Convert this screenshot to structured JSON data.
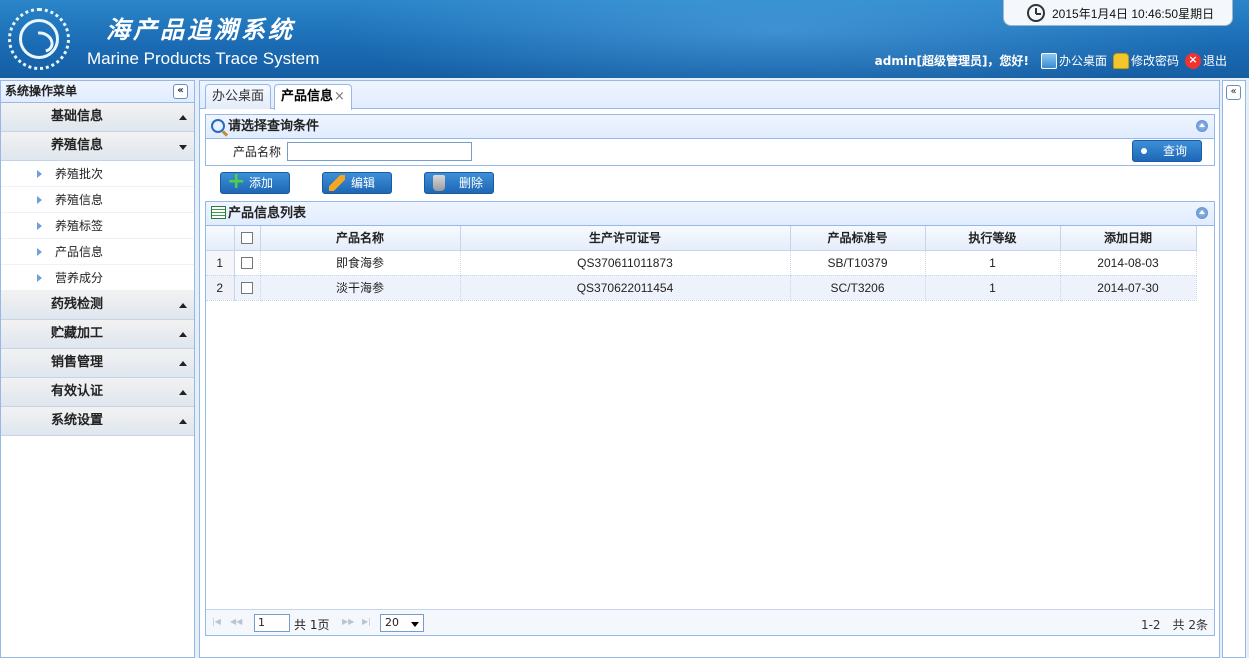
{
  "header": {
    "title_cn": "海产品追溯系统",
    "title_en": "Marine Products Trace System",
    "datetime": "2015年1月4日  10:46:50星期日",
    "greeting": "admin[超级管理员]，您好!",
    "links": {
      "desktop": "办公桌面",
      "change_password": "修改密码",
      "logout": "退出"
    }
  },
  "sidebar": {
    "title": "系统操作菜单",
    "collapse_glyph": "«",
    "groups": [
      {
        "label": "基础信息"
      },
      {
        "label": "养殖信息"
      },
      {
        "label": "药残检测"
      },
      {
        "label": "贮藏加工"
      },
      {
        "label": "销售管理"
      },
      {
        "label": "有效认证"
      },
      {
        "label": "系统设置"
      }
    ],
    "items": [
      {
        "label": "养殖批次"
      },
      {
        "label": "养殖信息"
      },
      {
        "label": "养殖标签"
      },
      {
        "label": "产品信息"
      },
      {
        "label": "营养成分"
      }
    ]
  },
  "tabs": [
    {
      "label": "办公桌面"
    },
    {
      "label": "产品信息",
      "close": "×"
    }
  ],
  "query": {
    "title": "请选择查询条件",
    "field_label": "产品名称",
    "field_value": "",
    "button": "查询"
  },
  "toolbar": {
    "add": "添加",
    "edit": "编辑",
    "delete": "删除"
  },
  "list": {
    "title": "产品信息列表",
    "columns": [
      "产品名称",
      "生产许可证号",
      "产品标准号",
      "执行等级",
      "添加日期"
    ],
    "rows": [
      {
        "n": "1",
        "name": "即食海参",
        "license": "QS370611011873",
        "standard": "SB/T10379",
        "level": "1",
        "date": "2014-08-03"
      },
      {
        "n": "2",
        "name": "淡干海参",
        "license": "QS370622011454",
        "standard": "SC/T3206",
        "level": "1",
        "date": "2014-07-30"
      }
    ]
  },
  "pager": {
    "page": "1",
    "total_pages": "共  1页",
    "page_size": "20",
    "info": "1-2　共 2条"
  },
  "colors": {
    "header": "#1b6cb4",
    "border": "#95b8e7",
    "button": "#1e67b5"
  }
}
